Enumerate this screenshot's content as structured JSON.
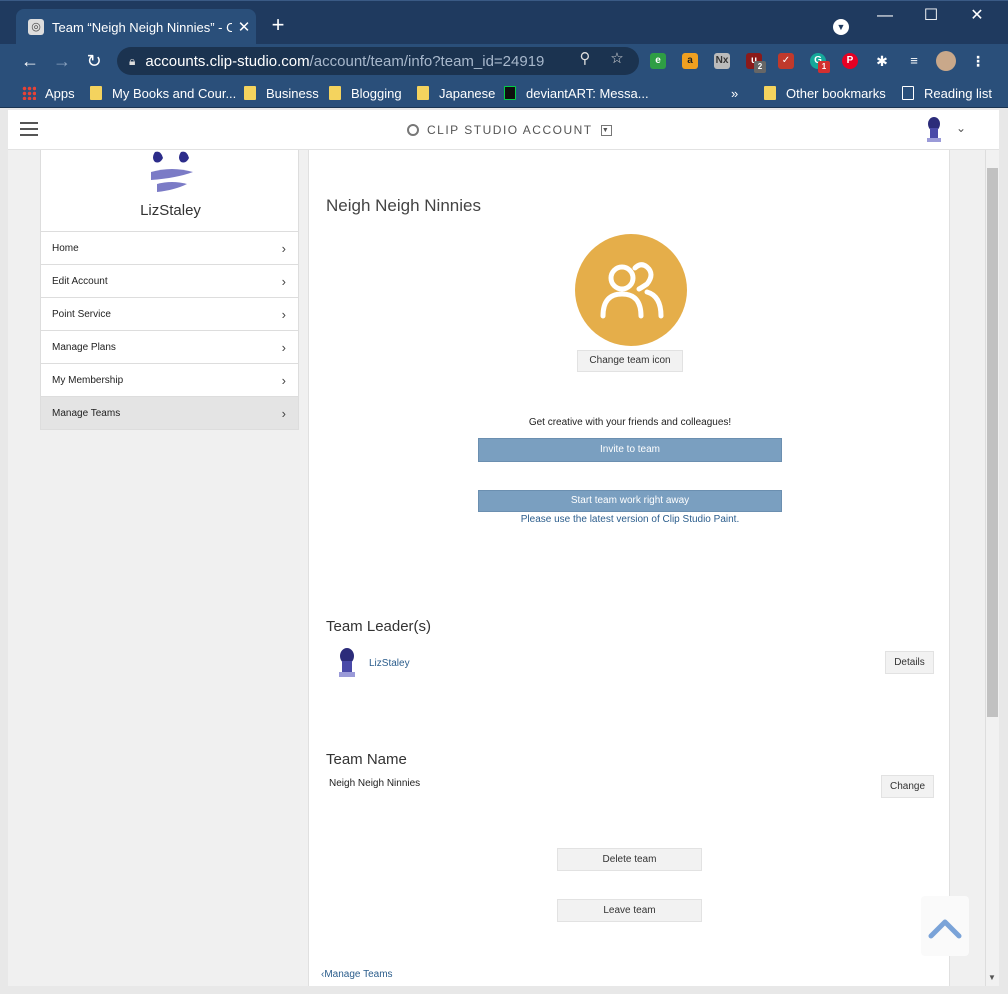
{
  "browser": {
    "tab_title": "Team “Neigh Neigh Ninnies” - Cl",
    "tab_close": "✕",
    "new_tab": "+",
    "url_host": "accounts.clip-studio.com",
    "url_path": "/account/team/info?team_id=24919",
    "ext_badges": {
      "ublock": "2",
      "grammarly": "1"
    },
    "bookmarks": [
      {
        "label": "Apps"
      },
      {
        "label": "My Books and Cour..."
      },
      {
        "label": "Business"
      },
      {
        "label": "Blogging"
      },
      {
        "label": "Japanese"
      },
      {
        "label": "deviantART: Messa..."
      }
    ],
    "overflow_chevron": "»",
    "other_bookmarks": "Other bookmarks",
    "reading_list": "Reading list"
  },
  "header": {
    "brand": "CLIP STUDIO ACCOUNT"
  },
  "sidebar": {
    "user_name": "LizStaley",
    "items": [
      {
        "label": "Home"
      },
      {
        "label": "Edit Account"
      },
      {
        "label": "Point Service"
      },
      {
        "label": "Manage Plans"
      },
      {
        "label": "My Membership"
      },
      {
        "label": "Manage Teams"
      }
    ]
  },
  "team": {
    "title": "Neigh Neigh Ninnies",
    "change_icon_label": "Change team icon",
    "promo_text": "Get creative with your friends and colleagues!",
    "invite_label": "Invite to team",
    "start_label": "Start team work right away",
    "version_note": "Please use the latest version of Clip Studio Paint.",
    "leaders_heading": "Team Leader(s)",
    "leader_name": "LizStaley",
    "details_label": "Details",
    "name_heading": "Team Name",
    "name_value": "Neigh Neigh Ninnies",
    "change_label": "Change",
    "delete_label": "Delete team",
    "leave_label": "Leave team",
    "back_link": "Manage Teams"
  },
  "colors": {
    "chrome_frame": "#1f3a5f",
    "team_icon_bg": "#e5ae4a",
    "primary_button": "#7a9fc0",
    "link": "#2b5d8c",
    "back_to_top": "#7aa3d8"
  }
}
